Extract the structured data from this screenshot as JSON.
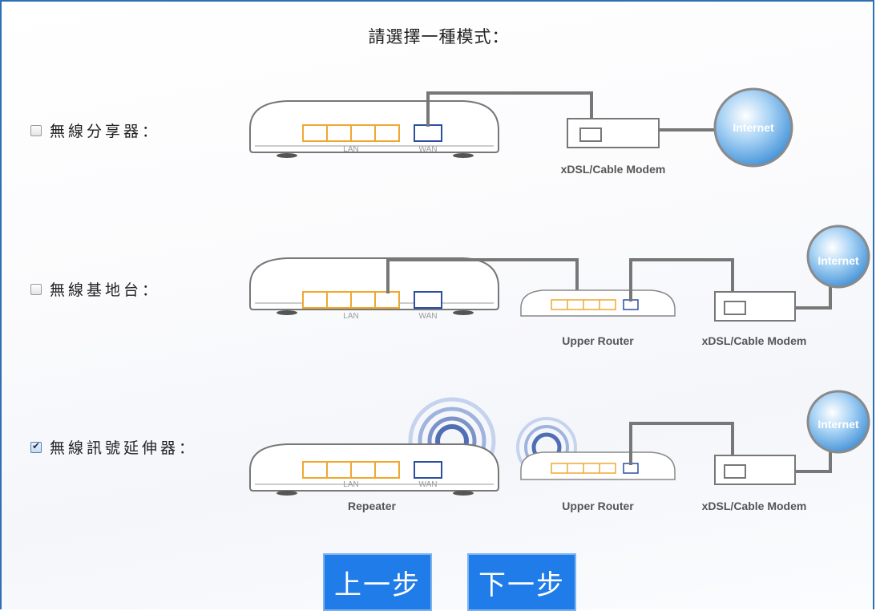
{
  "title": "請選擇一種模式：",
  "options": [
    {
      "label": "無線分享器：",
      "checked": false
    },
    {
      "label": "無線基地台：",
      "checked": false
    },
    {
      "label": "無線訊號延伸器：",
      "checked": true
    }
  ],
  "diagram_labels": {
    "lan": "LAN",
    "wan": "WAN",
    "modem": "xDSL/Cable Modem",
    "internet": "Internet",
    "upper_router": "Upper Router",
    "repeater": "Repeater"
  },
  "buttons": {
    "prev": "上一步",
    "next": "下一步"
  },
  "colors": {
    "lan_port": "#f0a830",
    "wan_port": "#2d4fa0",
    "cable": "#777777",
    "button": "#1f7ce8",
    "globe": "#6fb2ea"
  }
}
